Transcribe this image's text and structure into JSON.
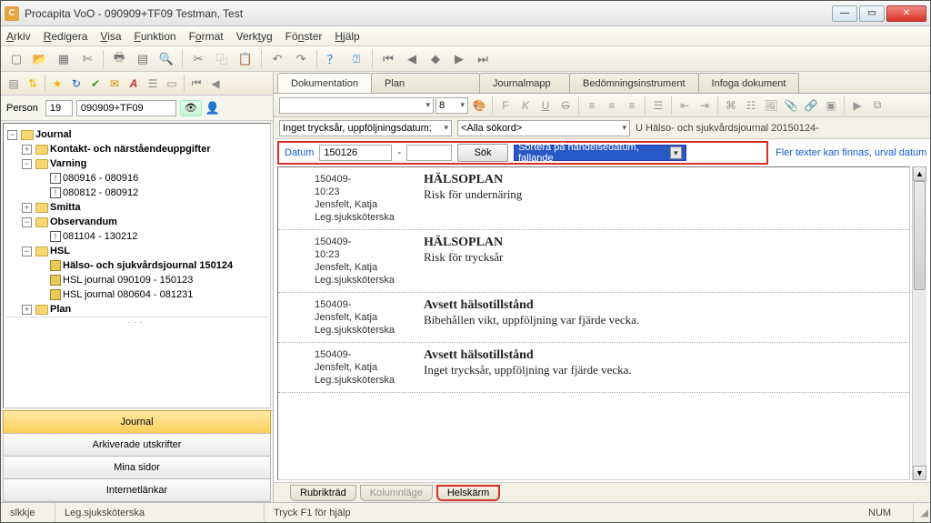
{
  "window": {
    "app_icon_letter": "C",
    "title": "Procapita VoO - 090909+TF09 Testman, Test"
  },
  "menu": {
    "arkiv": "Arkiv",
    "redigera": "Redigera",
    "visa": "Visa",
    "funktion": "Funktion",
    "format": "Format",
    "verktyg": "Verktyg",
    "fonster": "Fönster",
    "hjalp": "Hjälp"
  },
  "person": {
    "label": "Person",
    "id": "19",
    "code": "090909+TF09"
  },
  "tree": {
    "root": "Journal",
    "kontakt": "Kontakt- och närståendeuppgifter",
    "varning": "Varning",
    "varning_a": "080916 - 080916",
    "varning_b": "080812 - 080912",
    "smitta": "Smitta",
    "observandum": "Observandum",
    "observandum_a": "081104 - 130212",
    "hsl": "HSL",
    "hsl_a": "Hälso- och sjukvårdsjournal 150124",
    "hsl_b": "HSL journal 090109 - 150123",
    "hsl_c": "HSL journal 080604 - 081231",
    "plan": "Plan"
  },
  "left_buttons": {
    "journal": "Journal",
    "arkiverade": "Arkiverade utskrifter",
    "mina": "Mina sidor",
    "internet": "Internetlänkar"
  },
  "tabs": {
    "dokumentation": "Dokumentation",
    "plan": "Plan",
    "journalmapp": "Journalmapp",
    "bedomning": "Bedömningsinstrument",
    "infoga": "Infoga dokument"
  },
  "format_bar": {
    "font_size": "8"
  },
  "filter": {
    "left_combo": "Inget trycksår, uppföljningsdatum:",
    "mid_combo": "<Alla sökord>",
    "trail": "U Hälso- och sjukvårdsjournal 20150124-"
  },
  "search": {
    "label": "Datum",
    "value": "150126",
    "dash": "-",
    "sok": "Sök",
    "sort": "Sortera på händelsedatum, fallande",
    "link": "Fler texter kan finnas, urval datum"
  },
  "entries": [
    {
      "date": "150409-",
      "time": "10:23",
      "author": "Jensfelt, Katja",
      "role": "Leg.sjuksköterska",
      "heading": "HÄLSOPLAN",
      "text": "Risk för undernäring"
    },
    {
      "date": "150409-",
      "time": "10:23",
      "author": "Jensfelt, Katja",
      "role": "Leg.sjuksköterska",
      "heading": "HÄLSOPLAN",
      "text": "Risk för trycksår"
    },
    {
      "date": "150409-",
      "time": "",
      "author": "Jensfelt, Katja",
      "role": "Leg.sjuksköterska",
      "heading": "Avsett hälsotillstånd",
      "text": "Bibehållen vikt, uppföljning var fjärde vecka."
    },
    {
      "date": "150409-",
      "time": "",
      "author": "Jensfelt, Katja",
      "role": "Leg.sjuksköterska",
      "heading": "Avsett hälsotillstånd",
      "text": "Inget trycksår, uppföljning var fjärde vecka."
    }
  ],
  "bottom_tabs": {
    "rubrik": "Rubrikträd",
    "kolumn": "Kolumnläge",
    "helskarm": "Helskärm"
  },
  "status": {
    "user": "slkkje",
    "role": "Leg.sjuksköterska",
    "help": "Tryck F1 för hjälp",
    "num": "NUM"
  }
}
